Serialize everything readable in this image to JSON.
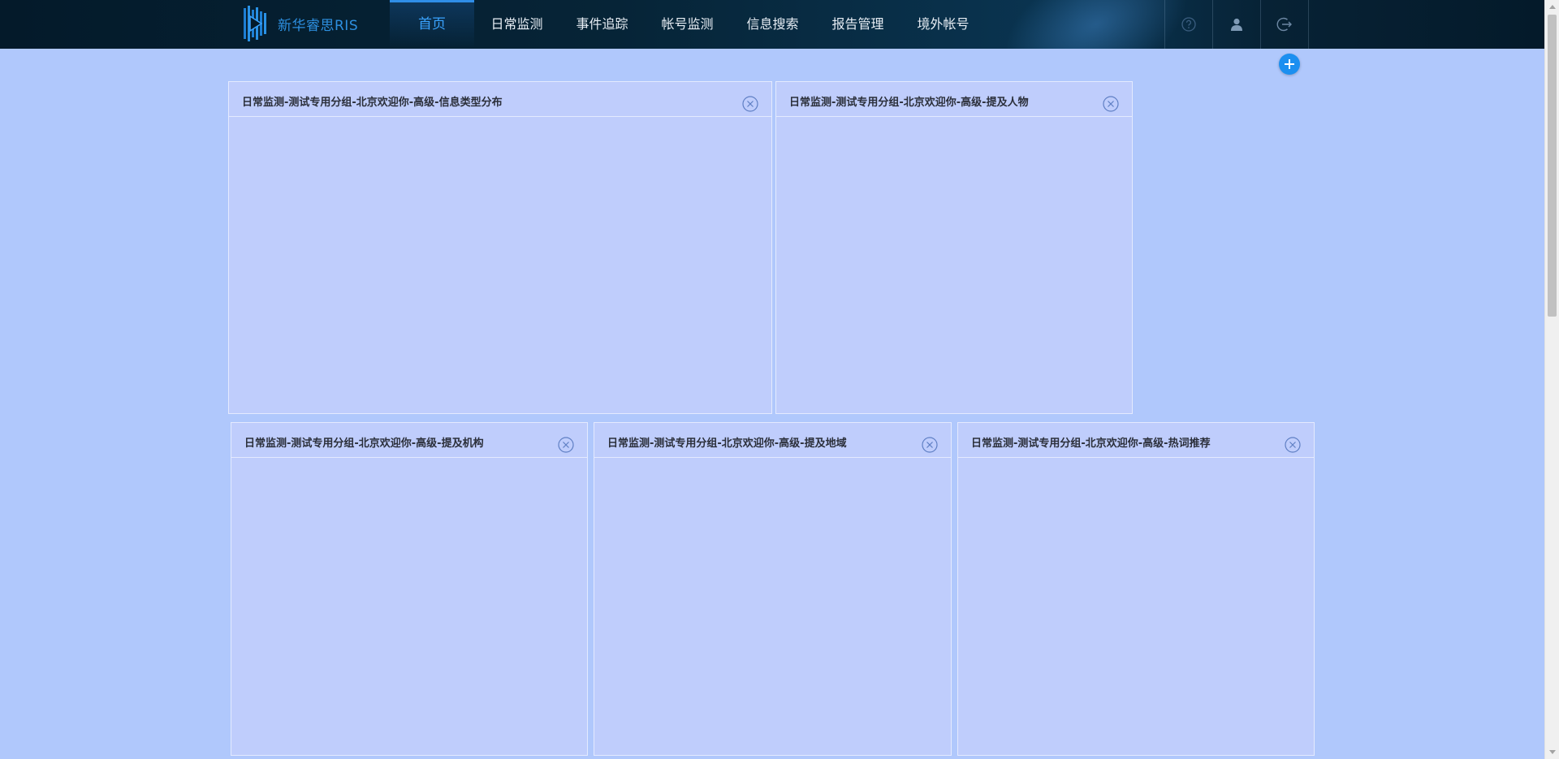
{
  "app": {
    "logo_text": "新华睿思RIS"
  },
  "nav": {
    "items": [
      {
        "label": "首页",
        "active": true
      },
      {
        "label": "日常监测",
        "active": false
      },
      {
        "label": "事件追踪",
        "active": false
      },
      {
        "label": "帐号监测",
        "active": false
      },
      {
        "label": "信息搜索",
        "active": false
      },
      {
        "label": "报告管理",
        "active": false
      },
      {
        "label": "境外帐号",
        "active": false
      }
    ]
  },
  "tools": {
    "icons": [
      "help-icon",
      "user-icon",
      "logout-icon"
    ]
  },
  "actions": {
    "add_icon": "plus-icon"
  },
  "panels": [
    {
      "title": "日常监测-测试专用分组-北京欢迎你-高级-信息类型分布"
    },
    {
      "title": "日常监测-测试专用分组-北京欢迎你-高级-提及人物"
    },
    {
      "title": "日常监测-测试专用分组-北京欢迎你-高级-提及机构"
    },
    {
      "title": "日常监测-测试专用分组-北京欢迎你-高级-提及地域"
    },
    {
      "title": "日常监测-测试专用分组-北京欢迎你-高级-热词推荐"
    }
  ],
  "colors": {
    "page_bg": "#b0c8fc",
    "panel_bg": "#bfcdfc",
    "accent": "#1b8ff0",
    "nav_active": "#3aa3ff"
  }
}
